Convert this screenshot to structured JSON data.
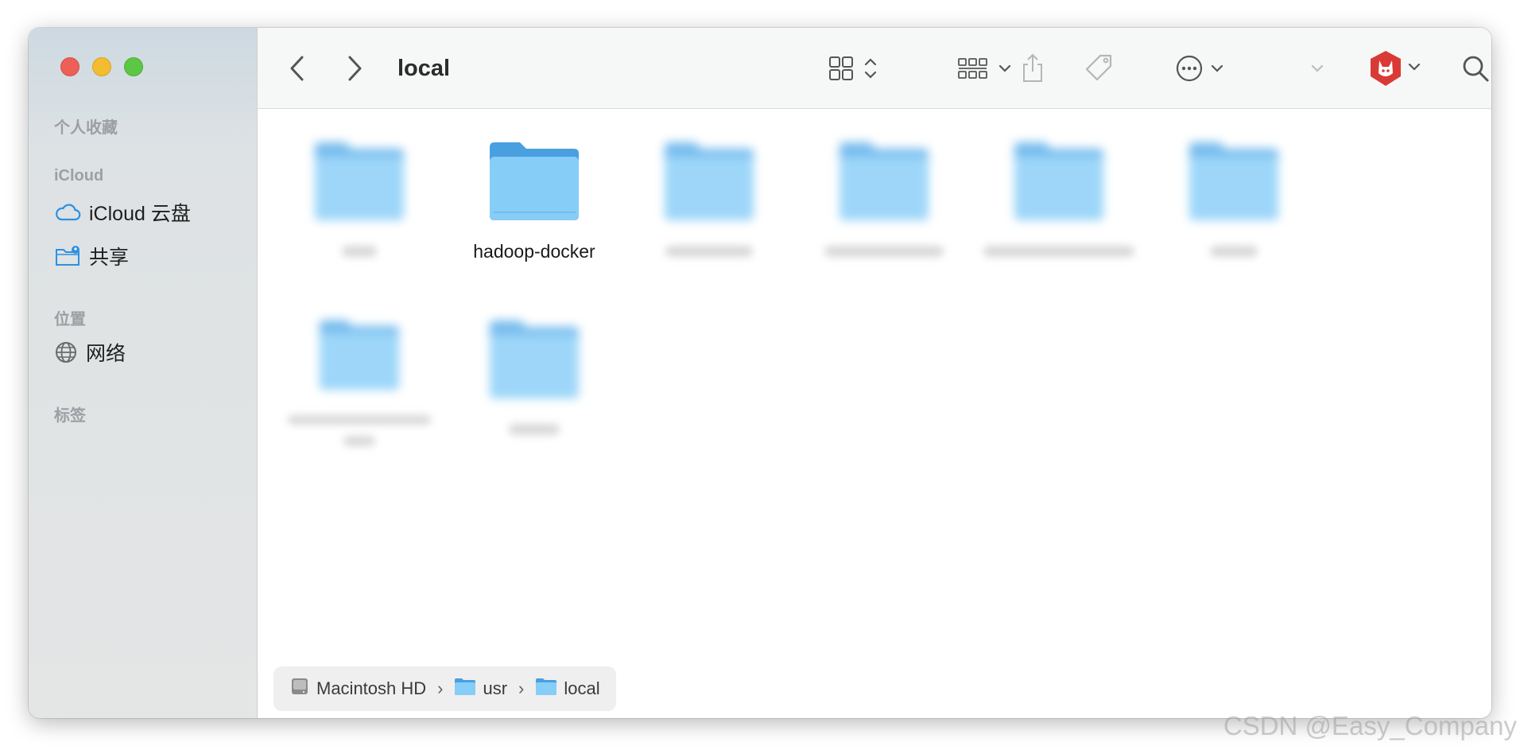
{
  "window": {
    "title": "local"
  },
  "sidebar": {
    "sections": [
      {
        "label": "个人收藏"
      },
      {
        "label": "iCloud"
      },
      {
        "label": "位置"
      },
      {
        "label": "标签"
      }
    ],
    "items": [
      {
        "label": "iCloud 云盘",
        "icon": "cloud-icon"
      },
      {
        "label": "共享",
        "icon": "shared-folder-icon"
      },
      {
        "label": "网络",
        "icon": "globe-icon"
      }
    ]
  },
  "toolbar": {
    "icons": [
      "back-icon",
      "forward-icon",
      "icon-view-icon",
      "group-icon",
      "share-icon",
      "tag-icon",
      "more-icon",
      "app-extension-icon",
      "search-icon"
    ]
  },
  "files": [
    {
      "name": "",
      "blurred": true
    },
    {
      "name": "hadoop-docker",
      "blurred": false
    },
    {
      "name": "",
      "blurred": true
    },
    {
      "name": "",
      "blurred": true
    },
    {
      "name": "",
      "blurred": true
    },
    {
      "name": "",
      "blurred": true
    },
    {
      "name": "",
      "blurred": true
    },
    {
      "name": "",
      "blurred": true
    }
  ],
  "pathbar": {
    "crumbs": [
      {
        "label": "Macintosh HD",
        "icon": "hard-drive-icon"
      },
      {
        "label": "usr",
        "icon": "folder-icon"
      },
      {
        "label": "local",
        "icon": "folder-icon"
      }
    ]
  },
  "watermark": "CSDN @Easy_Company",
  "colors": {
    "folder": "#7cc4f4",
    "accent": "#2f90e0",
    "close": "#ed5f57",
    "minimize": "#f4bc2f",
    "zoom": "#5cc645"
  }
}
